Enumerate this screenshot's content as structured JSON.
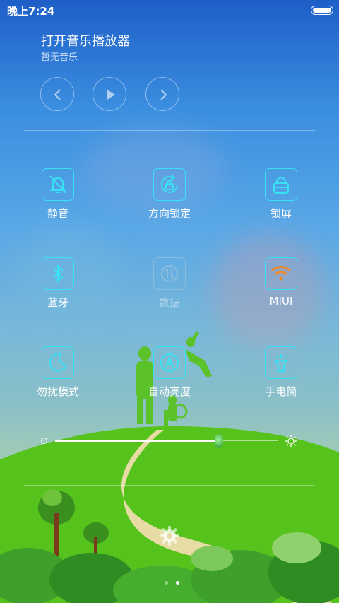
{
  "status": {
    "time": "晚上7:24"
  },
  "music": {
    "title": "打开音乐播放器",
    "subtitle": "暂无音乐",
    "prev_icon": "chevron-left-icon",
    "play_icon": "play-icon",
    "next_icon": "chevron-right-icon"
  },
  "tiles": [
    {
      "label": "静音",
      "icon": "bell-off-icon",
      "active": true
    },
    {
      "label": "方向锁定",
      "icon": "rotation-lock-icon",
      "active": true
    },
    {
      "label": "锁屏",
      "icon": "lock-icon",
      "active": true
    },
    {
      "label": "蓝牙",
      "icon": "bluetooth-icon",
      "active": true
    },
    {
      "label": "数据",
      "icon": "mobile-data-icon",
      "active": false
    },
    {
      "label": "MIUI",
      "icon": "wifi-icon",
      "active": true
    },
    {
      "label": "勿扰模式",
      "icon": "moon-icon",
      "active": true
    },
    {
      "label": "自动亮度",
      "icon": "auto-brightness-icon",
      "active": true
    },
    {
      "label": "手电筒",
      "icon": "flashlight-icon",
      "active": true
    }
  ],
  "brightness": {
    "level": 0.68
  },
  "pager": {
    "pages": 2,
    "current": 2
  },
  "colors": {
    "accent": "#38e2f5",
    "wifi": "#f08a24",
    "grass": "#56c31c",
    "path": "#e8dca6"
  }
}
